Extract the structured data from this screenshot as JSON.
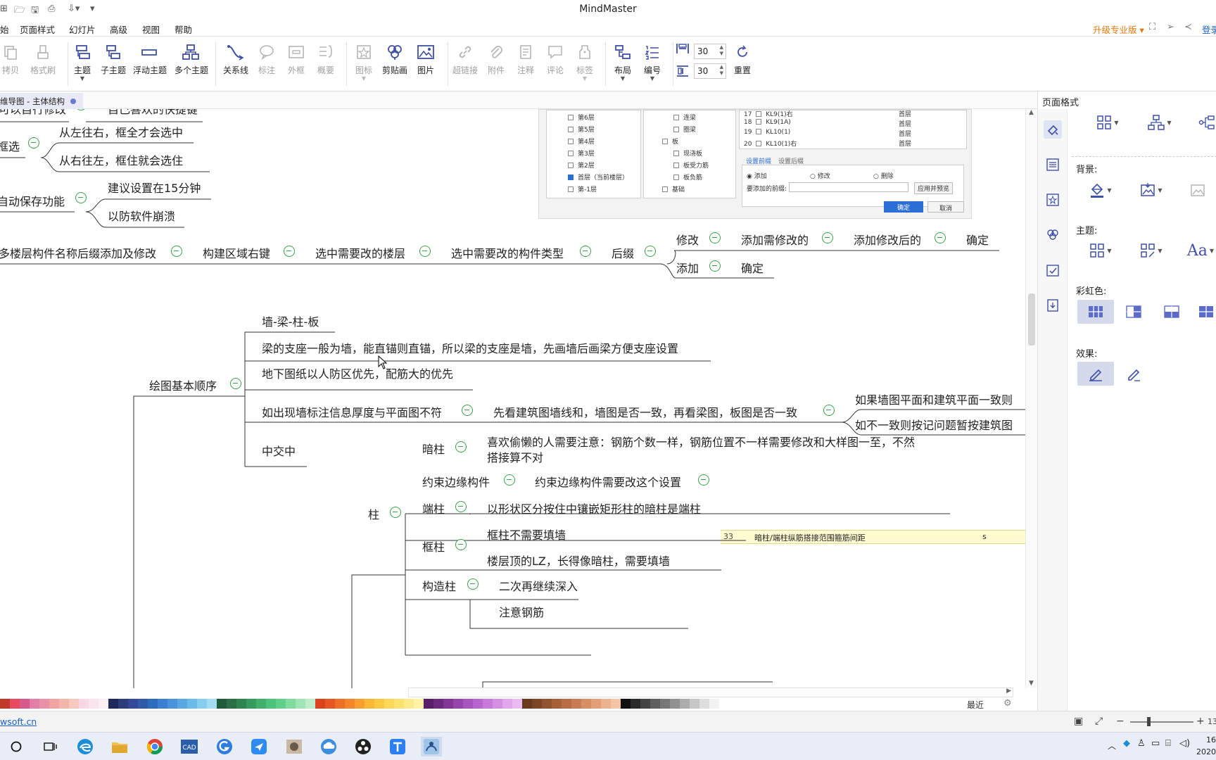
{
  "titlebar": {
    "app_title": "MindMaster"
  },
  "menu": {
    "items": [
      "始",
      "页面样式",
      "幻灯片",
      "高级",
      "视图",
      "帮助"
    ],
    "upgrade_label": "升级专业版",
    "login_label": "登录"
  },
  "ribbon": {
    "buttons": [
      {
        "label": "拷贝",
        "icon": "copy-icon",
        "disabled": true
      },
      {
        "label": "格式刷",
        "icon": "format-painter-icon",
        "disabled": true
      },
      {
        "label": "主题",
        "icon": "topic-icon",
        "disabled": false
      },
      {
        "label": "子主题",
        "icon": "subtopic-icon",
        "disabled": false
      },
      {
        "label": "浮动主题",
        "icon": "floating-topic-icon",
        "disabled": false
      },
      {
        "label": "多个主题",
        "icon": "multiple-topics-icon",
        "disabled": false
      },
      {
        "label": "关系线",
        "icon": "relationship-icon",
        "disabled": false
      },
      {
        "label": "标注",
        "icon": "callout-icon",
        "disabled": true
      },
      {
        "label": "外框",
        "icon": "boundary-icon",
        "disabled": true
      },
      {
        "label": "概要",
        "icon": "summary-icon",
        "disabled": true
      },
      {
        "label": "图标",
        "icon": "mark-icon",
        "disabled": true
      },
      {
        "label": "剪贴画",
        "icon": "clipart-icon",
        "disabled": false
      },
      {
        "label": "图片",
        "icon": "picture-icon",
        "disabled": false
      },
      {
        "label": "超链接",
        "icon": "hyperlink-icon",
        "disabled": true
      },
      {
        "label": "附件",
        "icon": "attachment-icon",
        "disabled": true
      },
      {
        "label": "注释",
        "icon": "note-icon",
        "disabled": true
      },
      {
        "label": "评论",
        "icon": "comment-icon",
        "disabled": true
      },
      {
        "label": "标签",
        "icon": "tag-icon",
        "disabled": true
      },
      {
        "label": "布局",
        "icon": "layout-icon",
        "disabled": false
      },
      {
        "label": "编号",
        "icon": "numbering-icon",
        "disabled": false
      },
      {
        "label": "重置",
        "icon": "reset-icon",
        "disabled": false
      }
    ],
    "spacing_h": "30",
    "spacing_v": "30"
  },
  "doc_tab": {
    "label": "维导图 - 主体结构"
  },
  "mindmap": {
    "row1": [
      "可以自行修改",
      "自己喜欢的快捷键"
    ],
    "frame_select": {
      "node": "框选",
      "children": [
        "从左往右，框全才会选中",
        "从右往左，框住就会选住"
      ]
    },
    "autosave": {
      "node": "自动保存功能",
      "children": [
        "建议设置在15分钟",
        "以防软件崩溃"
      ]
    },
    "suffix_chain": [
      "多楼层构件名称后缀添加及修改",
      "构建区域右键",
      "选中需要改的楼层",
      "选中需要改的构件类型",
      "后缀"
    ],
    "suffix_modify": [
      "修改",
      "添加需修改的",
      "添加修改后的",
      "确定"
    ],
    "suffix_add": [
      "添加",
      "确定"
    ],
    "drawing_order": {
      "node": "绘图基本顺序",
      "children": [
        "墙-梁-柱-板",
        "梁的支座一般为墙，能直锚则直锚，所以梁的支座是墙，先画墙后画梁方便支座设置",
        "地下图纸以人防区优先，配筋大的优先",
        "如出现墙标注信息厚度与平面图不符",
        "中交中"
      ],
      "wall_check": "先看建筑图墙线和，墙图是否一致，再看梁图，板图是否一致",
      "wall_check_children": [
        "如果墙图平面和建筑平面一致则",
        "如不一致则按记问题暂按建筑图"
      ]
    },
    "column": {
      "node": "柱",
      "dark_column": "暗柱",
      "dark_column_note_1": "喜欢偷懒的人需要注意：钢筋个数一样，钢筋位置不一样需要修改和大样图一至，不然",
      "dark_column_note_2": "搭接算不对",
      "boundary": "约束边缘构件",
      "boundary_note": "约束边缘构件需要改这个设置",
      "end_column": "端柱",
      "end_column_note": "以形状区分按住中镶嵌矩形柱的暗柱是端柱",
      "frame_column": "框柱",
      "frame_column_notes": [
        "框柱不需要填墙",
        "楼层顶的LZ，长得像暗柱，需要填墙"
      ],
      "structural_column": "构造柱",
      "structural_column_note": "二次再继续深入",
      "rebar_note": "注意钢筋"
    }
  },
  "embed_dialog": {
    "floors": [
      "第6层",
      "第5层",
      "第4层",
      "第3层",
      "第2层",
      "首层（当前楼层）",
      "第-1层"
    ],
    "types": [
      "连梁",
      "圈梁",
      "板",
      "现浇板",
      "板受力筋",
      "板负筋",
      "基础"
    ],
    "table_rows": [
      {
        "no": "17",
        "name": "KL9(1)右",
        "floor": "首层"
      },
      {
        "no": "18",
        "name": "KL9(1A)",
        "floor": "首层"
      },
      {
        "no": "19",
        "name": "KL10(1)",
        "floor": "首层"
      },
      {
        "no": "20",
        "name": "KL10(1)右",
        "floor": "首层"
      }
    ],
    "tabs": [
      "设置前缀",
      "设置后缀"
    ],
    "radios": [
      "添加",
      "修改",
      "删除"
    ],
    "prefix_label": "要添加的前缀:",
    "apply_label": "应用并预览",
    "ok_label": "确定",
    "cancel_label": "取消"
  },
  "embed_table": {
    "row_no": "33",
    "row_text": "暗柱/端柱纵筋搭接范围箍筋间距",
    "row_value": "s"
  },
  "palette_recent": "最近",
  "status": {
    "link": "wsoft.cn",
    "zoom_value": "13"
  },
  "right_panel": {
    "title": "页面格式",
    "background": "背景:",
    "theme": "主题:",
    "rainbow": "彩虹色:",
    "effect": "效果:"
  },
  "clock": {
    "time": "16",
    "date": "2020"
  },
  "colors": {
    "accent": "#2b6fd6",
    "collapse_green": "#3aa34a",
    "upgrade_orange": "#e8780a",
    "icon_blue": "#3f4fa8"
  }
}
